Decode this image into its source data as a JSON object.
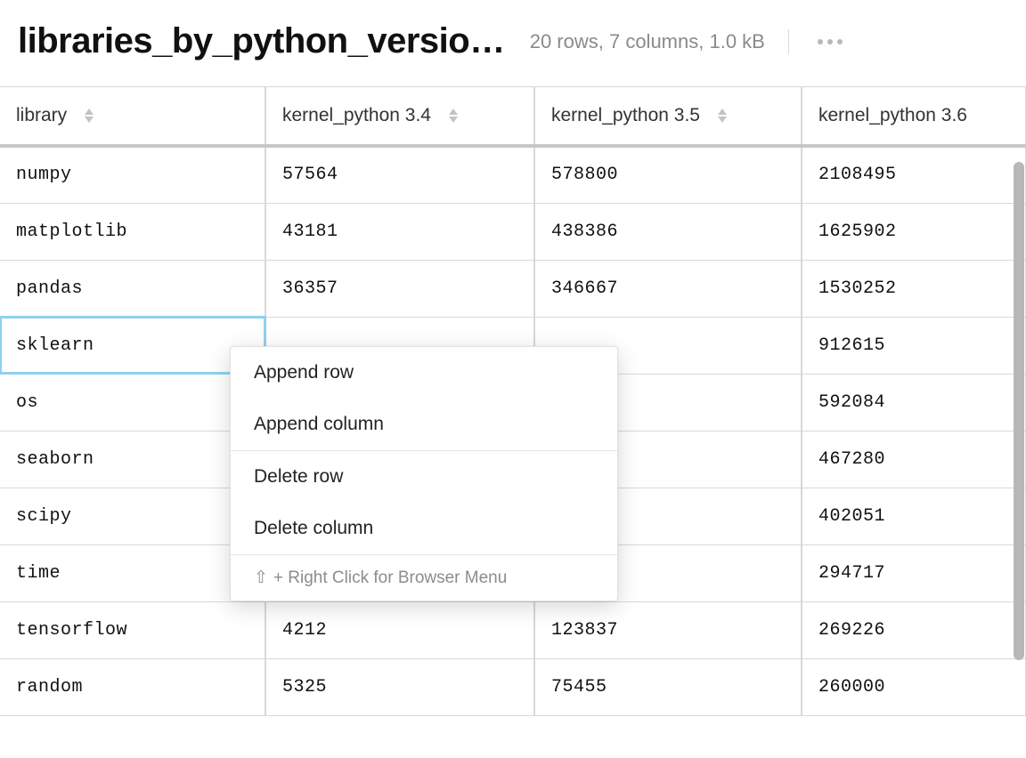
{
  "header": {
    "title": "libraries_by_python_versio…",
    "stats": "20 rows, 7 columns, 1.0 kB"
  },
  "columns": [
    {
      "label": "library",
      "sortable": true
    },
    {
      "label": "kernel_python 3.4",
      "sortable": true
    },
    {
      "label": "kernel_python 3.5",
      "sortable": true
    },
    {
      "label": "kernel_python 3.6",
      "sortable": false
    }
  ],
  "rows": [
    {
      "library": "numpy",
      "k34": "57564",
      "k35": "578800",
      "k36": "2108495"
    },
    {
      "library": "matplotlib",
      "k34": "43181",
      "k35": "438386",
      "k36": "1625902"
    },
    {
      "library": "pandas",
      "k34": "36357",
      "k35": "346667",
      "k36": "1530252"
    },
    {
      "library": "sklearn",
      "k34": "",
      "k35": "",
      "k36": "912615"
    },
    {
      "library": "os",
      "k34": "",
      "k35": "",
      "k36": "592084"
    },
    {
      "library": "seaborn",
      "k34": "",
      "k35": "",
      "k36": "467280"
    },
    {
      "library": "scipy",
      "k34": "",
      "k35": "",
      "k36": "402051"
    },
    {
      "library": "time",
      "k34": "",
      "k35": "",
      "k36": "294717"
    },
    {
      "library": "tensorflow",
      "k34": "4212",
      "k35": "123837",
      "k36": "269226"
    },
    {
      "library": "random",
      "k34": "5325",
      "k35": "75455",
      "k36": "260000"
    }
  ],
  "selected_cell": {
    "row": 3,
    "col": "library"
  },
  "context_menu": {
    "items": [
      {
        "label": "Append row"
      },
      {
        "label": "Append column"
      }
    ],
    "items2": [
      {
        "label": "Delete row"
      },
      {
        "label": "Delete column"
      }
    ],
    "hint_prefix": "⇧",
    "hint_text": "+ Right Click for Browser Menu"
  }
}
